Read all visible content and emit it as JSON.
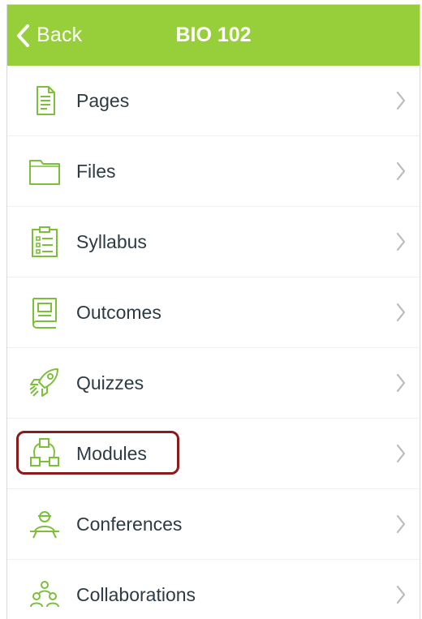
{
  "header": {
    "back_label": "Back",
    "title": "BIO 102",
    "background_color": "#97cf3b"
  },
  "menu": {
    "items": [
      {
        "label": "Pages",
        "icon": "document-icon"
      },
      {
        "label": "Files",
        "icon": "folder-icon"
      },
      {
        "label": "Syllabus",
        "icon": "clipboard-icon"
      },
      {
        "label": "Outcomes",
        "icon": "book-icon"
      },
      {
        "label": "Quizzes",
        "icon": "rocket-icon"
      },
      {
        "label": "Modules",
        "icon": "modules-icon",
        "highlighted": true
      },
      {
        "label": "Conferences",
        "icon": "conference-icon"
      },
      {
        "label": "Collaborations",
        "icon": "collaborations-icon"
      }
    ]
  },
  "colors": {
    "icon": "#7cbf3a",
    "text": "#2d3b45",
    "chevron": "#b8bcc0",
    "highlight_border": "#8b1a1a"
  }
}
